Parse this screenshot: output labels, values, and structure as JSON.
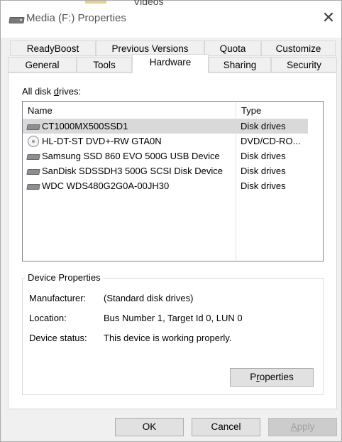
{
  "window": {
    "title": "Media (F:) Properties",
    "background_label": "Videos"
  },
  "tabs_top": [
    {
      "label": "ReadyBoost"
    },
    {
      "label": "Previous Versions"
    },
    {
      "label": "Quota"
    },
    {
      "label": "Customize"
    }
  ],
  "tabs_bottom": [
    {
      "label": "General"
    },
    {
      "label": "Tools"
    },
    {
      "label": "Hardware",
      "active": true
    },
    {
      "label": "Sharing"
    },
    {
      "label": "Security"
    }
  ],
  "drives_list": {
    "label_prefix": "All disk ",
    "label_underlined": "d",
    "label_suffix": "rives:",
    "columns": {
      "name": "Name",
      "type": "Type"
    },
    "rows": [
      {
        "name": "CT1000MX500SSD1",
        "type": "Disk drives",
        "icon": "disk-drive-icon",
        "selected": true
      },
      {
        "name": "HL-DT-ST DVD+-RW GTA0N",
        "type": "DVD/CD-RO...",
        "icon": "optical-drive-icon"
      },
      {
        "name": "Samsung SSD 860 EVO 500G USB Device",
        "type": "Disk drives",
        "icon": "disk-drive-icon"
      },
      {
        "name": "SanDisk SDSSDH3 500G SCSI Disk Device",
        "type": "Disk drives",
        "icon": "disk-drive-icon"
      },
      {
        "name": "WDC WDS480G2G0A-00JH30",
        "type": "Disk drives",
        "icon": "disk-drive-icon"
      }
    ]
  },
  "device_properties": {
    "title": "Device Properties",
    "manufacturer_label": "Manufacturer:",
    "manufacturer_value": "(Standard disk drives)",
    "location_label": "Location:",
    "location_value": "Bus Number 1, Target Id 0, LUN 0",
    "status_label": "Device status:",
    "status_value": "This device is working properly.",
    "properties_button_prefix": "P",
    "properties_button_underlined": "r",
    "properties_button_suffix": "operties"
  },
  "buttons": {
    "ok": "OK",
    "cancel": "Cancel",
    "apply_underlined": "A",
    "apply_suffix": "pply"
  }
}
